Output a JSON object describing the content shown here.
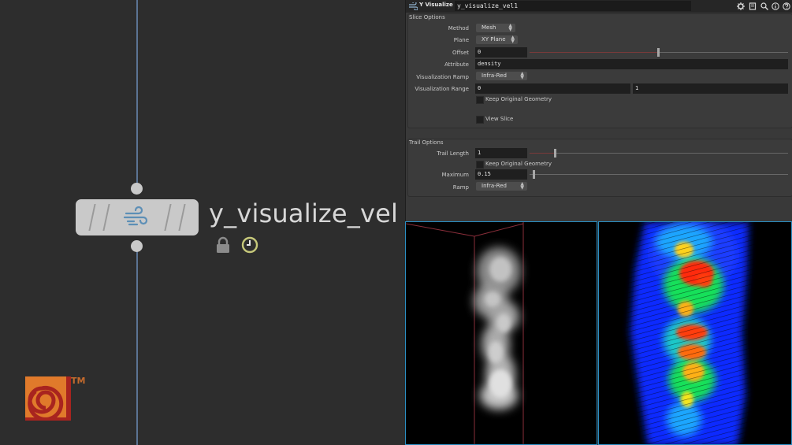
{
  "network": {
    "node_name": "y_visualize_vel",
    "node_icon": "wind-icon",
    "status_icons": [
      "lock-icon",
      "clock-icon"
    ],
    "logo": "houdini-logo",
    "logo_mark": "TM"
  },
  "parameter_panel": {
    "node_type_label": "Y Visualize Vel",
    "node_name_value": "y_visualize_vel1",
    "toolbar_icons": [
      "gear-icon",
      "help-book-icon",
      "zoom-icon",
      "info-icon",
      "question-icon"
    ],
    "slice_options": {
      "label": "Slice Options",
      "method": {
        "label": "Method",
        "value": "Mesh"
      },
      "plane": {
        "label": "Plane",
        "value": "XY Plane"
      },
      "offset": {
        "label": "Offset",
        "value": "0",
        "slider_fraction": 0.5
      },
      "attribute": {
        "label": "Attribute",
        "value": "density"
      },
      "visualization_ramp": {
        "label": "Visualization Ramp",
        "value": "Infra-Red"
      },
      "visualization_range": {
        "label": "Visualization Range",
        "min": "0",
        "max": "1"
      },
      "keep_original_geometry": {
        "label": "Keep Original Geometry",
        "checked": false
      },
      "view_slice": {
        "label": "View Slice",
        "checked": false
      }
    },
    "trail_options": {
      "label": "Trail Options",
      "trail_length": {
        "label": "Trail Length",
        "value": "1",
        "slider_fraction": 0.1
      },
      "keep_original_geometry": {
        "label": "Keep Original Geometry",
        "checked": false
      },
      "maximum": {
        "label": "Maximum",
        "value": "0.15",
        "slider_fraction": 0.02
      },
      "ramp": {
        "label": "Ramp",
        "value": "Infra-Red"
      }
    }
  },
  "viewports": {
    "left": {
      "content": "density smoke render",
      "colors": {
        "smoke": "#d0d0d0",
        "guides": "#8a2e3a"
      }
    },
    "right": {
      "content": "velocity trails visualization",
      "colors": {
        "low": "#0a2cff",
        "mid": "#19e05a",
        "high": "#ff2a10"
      }
    }
  },
  "colors": {
    "wire": "#5b7393",
    "node_body": "#c9c9c9",
    "viewport_border": "#2a8fc4",
    "logo_orange": "#e07a2b",
    "logo_red": "#a8241f"
  }
}
